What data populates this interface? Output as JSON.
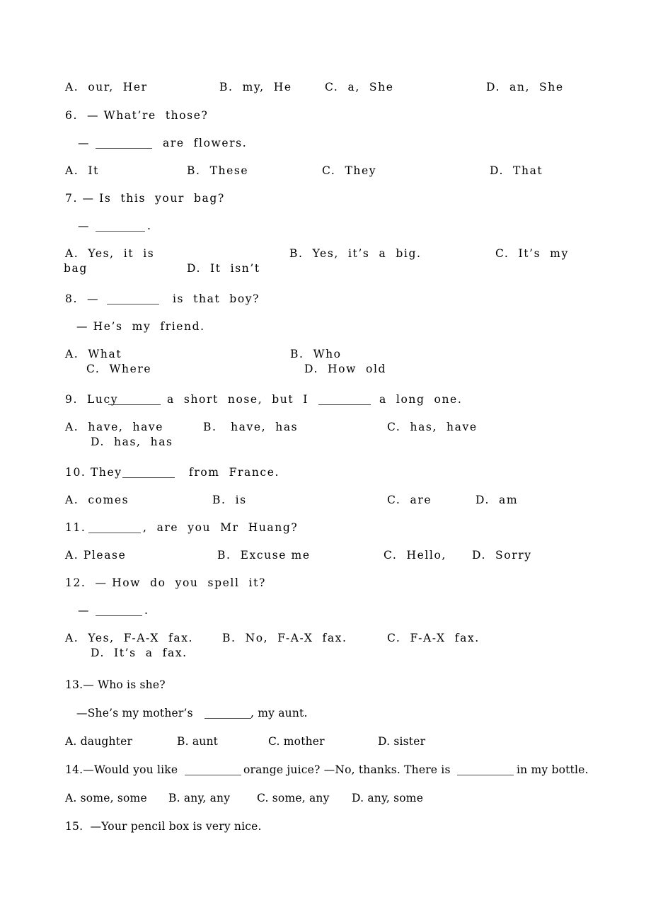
{
  "document": {
    "type": "english-grammar-worksheet",
    "page_background": "#ffffff",
    "text_color": "#111111",
    "rule_color": "#4a4a4a"
  },
  "q5_options": {
    "a": "A.  our,  Her",
    "b": "B.  my,  He",
    "c": "C.  a,  She",
    "d": "D.  an,  She"
  },
  "q6": {
    "stem": "6.  — What’re  those?",
    "stem2_pre": "—",
    "stem2_post": "are  flowers.",
    "a": "A.  It",
    "b": "B.  These",
    "c": "C.  They",
    "d": "D.  That"
  },
  "q7": {
    "stem": "7. — Is  this  your  bag?",
    "stem2_pre": "—",
    "stem2_post": ".",
    "a": "A.  Yes,  it  is",
    "b": "B.  Yes,  it’s  a  big.",
    "c": "C.  It’s  my",
    "c_wrap": "bag",
    "d": "D.  It  isn’t"
  },
  "q8": {
    "stem_pre": "8.  —",
    "stem_post": "is  that  boy?",
    "stem2": "— He’s  my  friend.",
    "a": "A.  What",
    "b": "B.  Who",
    "c": "C.  Where",
    "d": "D.  How  old"
  },
  "q9": {
    "stem_pre": "9.  Lucy",
    "stem_mid": "a  short  nose,  but  I",
    "stem_post": "a  long  one.",
    "a": "A.  have,  have",
    "b": "B.   have,  has",
    "c": "C.  has,  have",
    "d": "D.  has,  has"
  },
  "q10": {
    "stem_pre": "10. They",
    "stem_post": "from  France.",
    "a": "A.  comes",
    "b": "B.  is",
    "c": "C.  are",
    "d": "D.  am"
  },
  "q11": {
    "stem_pre": "11.",
    "stem_post": ",  are  you  Mr  Huang?",
    "a": "A. Please",
    "b": "B.  Excuse me",
    "c": "C.  Hello,",
    "d": "D.  Sorry"
  },
  "q12": {
    "stem": "12.  — How  do  you  spell  it?",
    "stem2_pre": "—",
    "stem2_post": ".",
    "a": "A.  Yes,  F-A-X  fax.",
    "b": "B.  No,  F-A-X  fax.",
    "c": "C.  F-A-X  fax.",
    "d": "D.  It’s  a  fax."
  },
  "q13": {
    "stem": "13.— Who is she?",
    "stem2_pre": "—She’s my mother’s",
    "stem2_post": ", my aunt.",
    "a": "A. daughter",
    "b": "B. aunt",
    "c": "C. mother",
    "d": "D. sister"
  },
  "q14": {
    "stem_pre": "14.—Would you like",
    "stem_mid": "orange juice? —No, thanks. There is",
    "stem_post": "in my bottle.",
    "a": "A. some, some",
    "b": "B. any, any",
    "c": "C. some, any",
    "d": "D. any, some"
  },
  "q15": {
    "stem": "15.  —Your pencil box is very nice."
  }
}
